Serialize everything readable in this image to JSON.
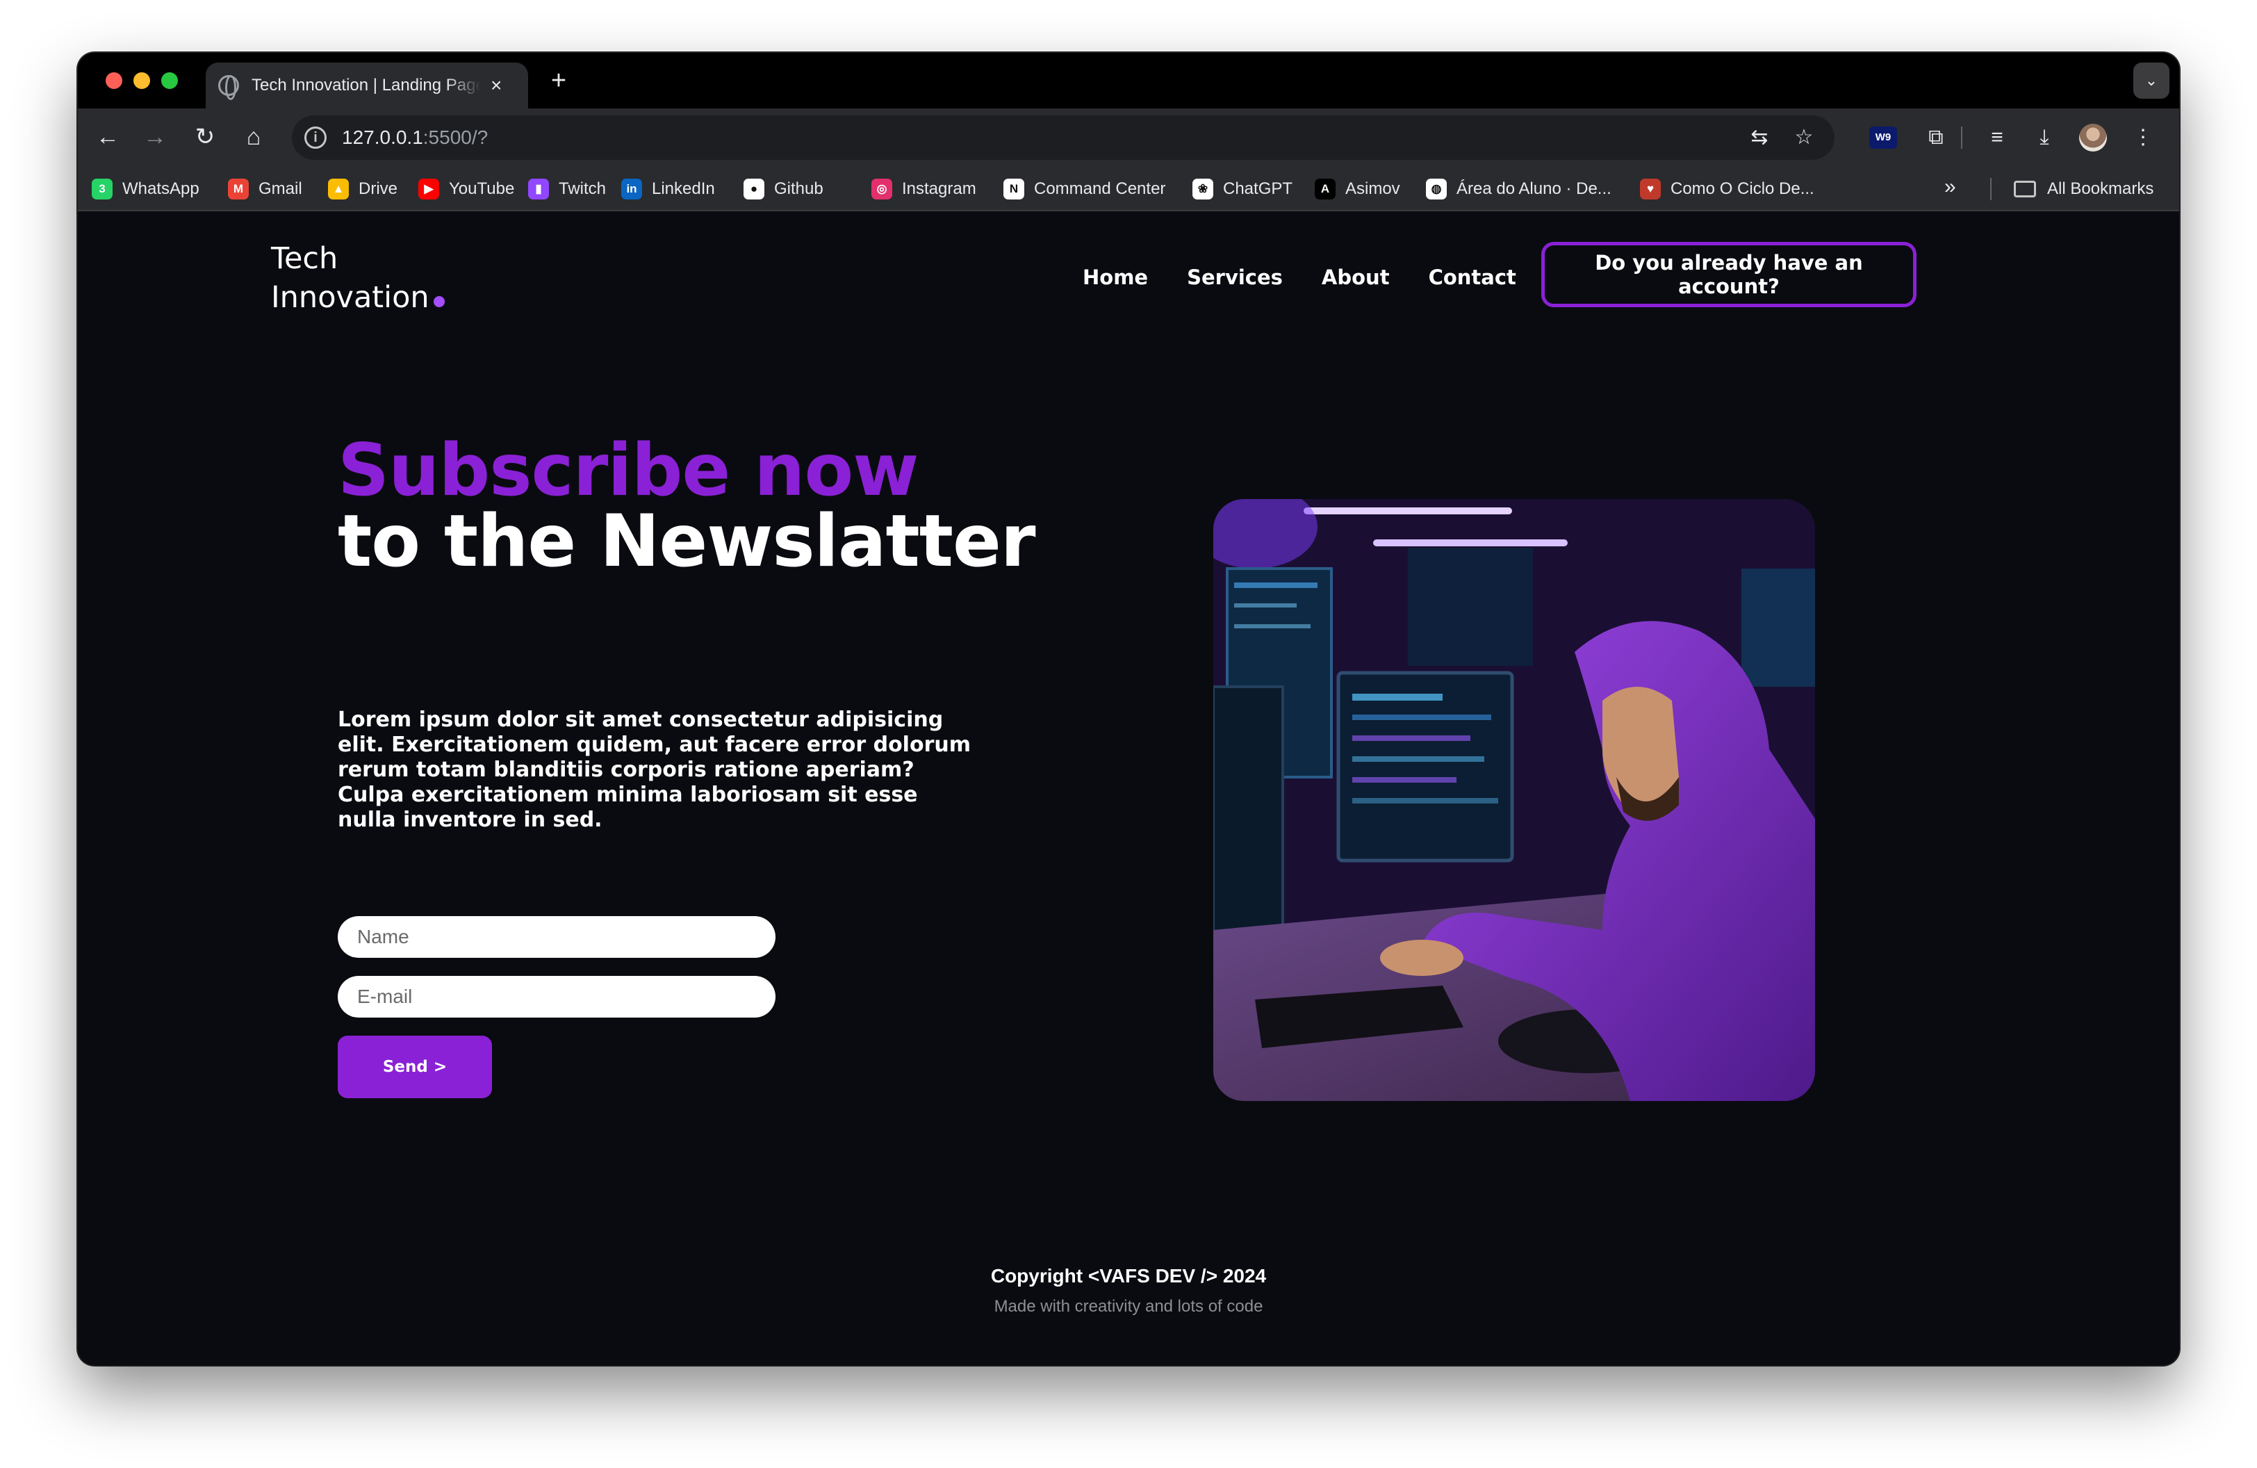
{
  "browser": {
    "tab_title": "Tech Innovation | Landing Page",
    "new_tab": "+",
    "tab_close": "×",
    "url_host": "127.0.0.1",
    "url_rest": ":5500/?",
    "ext_w9": "W9",
    "bookmarks": [
      {
        "label": "WhatsApp",
        "icon": "whatsapp-icon",
        "color": "#25d366",
        "glyph": "3"
      },
      {
        "label": "Gmail",
        "icon": "gmail-icon",
        "color": "#ea4335",
        "glyph": "M"
      },
      {
        "label": "Drive",
        "icon": "drive-icon",
        "color": "#fbbc04",
        "glyph": "▲"
      },
      {
        "label": "YouTube",
        "icon": "youtube-icon",
        "color": "#ff0000",
        "glyph": "▶"
      },
      {
        "label": "Twitch",
        "icon": "twitch-icon",
        "color": "#9146ff",
        "glyph": "▮"
      },
      {
        "label": "LinkedIn",
        "icon": "linkedin-icon",
        "color": "#0a66c2",
        "glyph": "in"
      },
      {
        "label": "Github",
        "icon": "github-icon",
        "color": "#ffffff",
        "glyph": "●"
      },
      {
        "label": "Instagram",
        "icon": "instagram-icon",
        "color": "#e1306c",
        "glyph": "◎"
      },
      {
        "label": "Command Center",
        "icon": "notion-icon",
        "color": "#ffffff",
        "glyph": "N"
      },
      {
        "label": "ChatGPT",
        "icon": "chatgpt-icon",
        "color": "#ffffff",
        "glyph": "❀"
      },
      {
        "label": "Asimov",
        "icon": "asimov-icon",
        "color": "#000000",
        "glyph": "A"
      },
      {
        "label": "Área do Aluno · De...",
        "icon": "globe-icon",
        "color": "#ffffff",
        "glyph": "◍"
      },
      {
        "label": "Como O Ciclo De...",
        "icon": "site-icon",
        "color": "#c0392b",
        "glyph": "♥"
      }
    ],
    "more_bookmarks": "»",
    "all_bookmarks": "All Bookmarks"
  },
  "site": {
    "logo_line1": "Tech",
    "logo_line2": "Innovation",
    "nav": [
      "Home",
      "Services",
      "About",
      "Contact"
    ],
    "account_button": "Do you already have an account?",
    "heading_accent": "Subscribe now",
    "heading_main": "to the Newslatter",
    "lead": "Lorem ipsum dolor sit amet consectetur adipisicing elit. Exercitationem quidem, aut facere error dolorum rerum totam blanditiis corporis ratione aperiam? Culpa exercitationem minima laboriosam sit esse nulla inventore in sed.",
    "name_placeholder": "Name",
    "email_placeholder": "E-mail",
    "send_button": "Send >",
    "footer_copyright": "Copyright <VAFS DEV /> 2024",
    "footer_tagline": "Made with creativity and lots of code"
  },
  "colors": {
    "accent": "#8a21d6",
    "page_bg": "#0a0b10"
  }
}
